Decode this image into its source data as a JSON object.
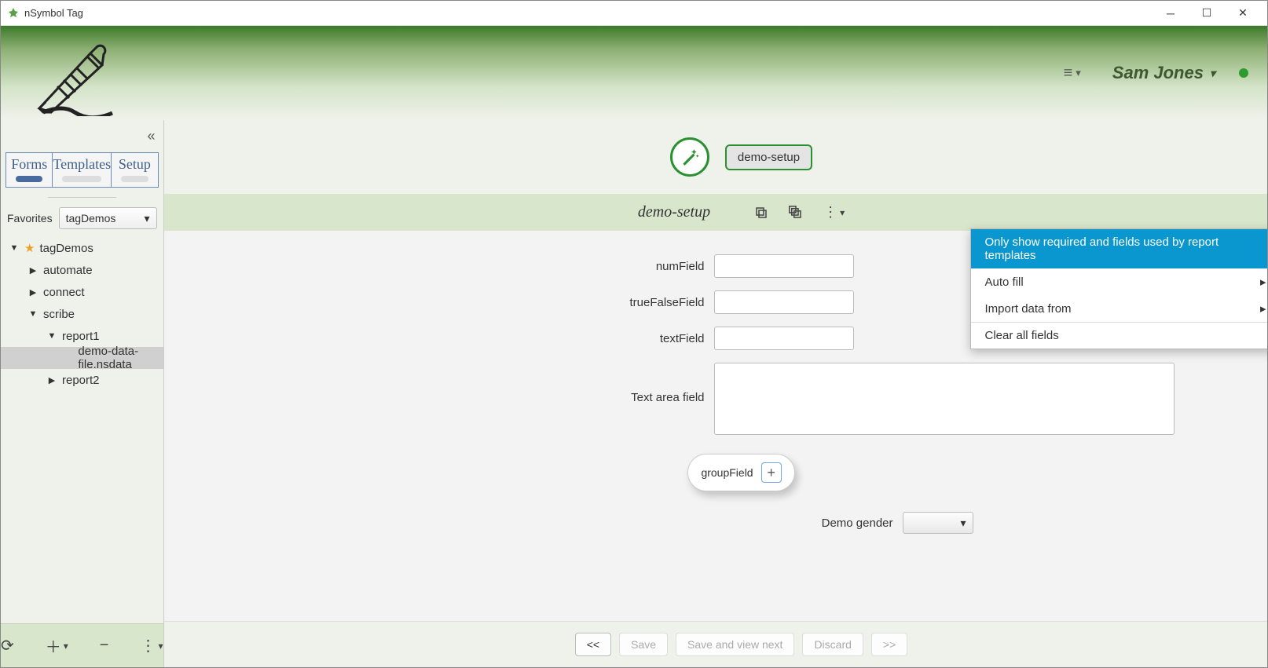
{
  "app": {
    "title": "nSymbol Tag"
  },
  "header": {
    "user": "Sam Jones"
  },
  "sidebar": {
    "tabs": [
      {
        "label": "Forms",
        "active": true
      },
      {
        "label": "Templates",
        "active": false
      },
      {
        "label": "Setup",
        "active": false
      }
    ],
    "favorites_label": "Favorites",
    "favorites_selected": "tagDemos",
    "tree": {
      "root": "tagDemos",
      "children": [
        "automate",
        "connect",
        "scribe"
      ],
      "scribe_children": [
        "report1",
        "report2"
      ],
      "report1_children": [
        "demo-data-file.nsdata"
      ],
      "selected": "demo-data-file.nsdata"
    }
  },
  "main": {
    "setup_pill": "demo-setup",
    "form_title": "demo-setup",
    "fields": {
      "numField_label": "numField",
      "trueFalseField_label": "trueFalseField",
      "textField_label": "textField",
      "textarea_label": "Text area field",
      "groupField_label": "groupField",
      "demoGender_label": "Demo gender"
    },
    "menu": {
      "item1": "Only show required and fields used by report templates",
      "item2": "Auto fill",
      "item3": "Import data from",
      "item4": "Clear all fields"
    },
    "footer": {
      "prev": "<<",
      "save": "Save",
      "save_next": "Save and view next",
      "discard": "Discard",
      "next": ">>"
    }
  }
}
